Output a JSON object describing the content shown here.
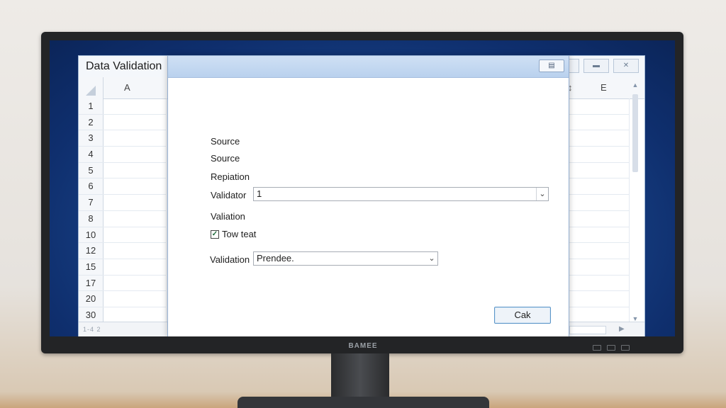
{
  "spreadsheet": {
    "title": "Data Validation",
    "columns": [
      "A",
      "E"
    ],
    "row_numbers": [
      "1",
      "2",
      "3",
      "4",
      "5",
      "6",
      "7",
      "8",
      "10",
      "12",
      "15",
      "17",
      "20",
      "30"
    ],
    "sheet_tabs_text": "1-4 2"
  },
  "dialog": {
    "labels": {
      "source_1": "Source",
      "source_2": "Source",
      "repiation": "Repiation",
      "validator_1": "Validator",
      "validation": "Valiation",
      "validator_2": "Validation"
    },
    "validator_combo_value": "1",
    "checkbox_label": "Tow teat",
    "checkbox_checked": "✓",
    "validation_combo_value": "Prendee.",
    "ok_button_label": "Cak"
  },
  "monitor": {
    "brand": "BAMEE"
  },
  "icons": {
    "dropdown": "chevron-down-icon",
    "close": "close-icon",
    "restore": "restore-icon",
    "minimize": "minimize-icon"
  }
}
